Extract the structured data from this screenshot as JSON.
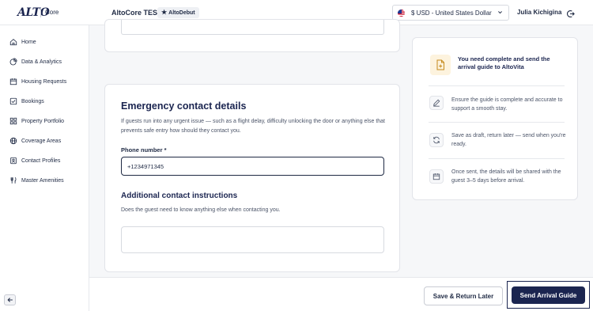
{
  "header": {
    "logo_text": "ALTO",
    "logo_sub": "Core",
    "account_name": "AltoCore TEST",
    "badge_label": "AltoDebut",
    "currency": {
      "selected": "$ USD - United States Dollar",
      "flag_icon": "us-flag-icon"
    },
    "user_name": "Julia Kichigina",
    "logout_icon": "logout-icon"
  },
  "sidebar": {
    "items": [
      {
        "label": "Home",
        "icon": "home-icon"
      },
      {
        "label": "Data & Analytics",
        "icon": "analytics-icon"
      },
      {
        "label": "Housing Requests",
        "icon": "calendar-icon"
      },
      {
        "label": "Bookings",
        "icon": "bookings-icon"
      },
      {
        "label": "Property Portfolio",
        "icon": "grid-icon"
      },
      {
        "label": "Coverage Areas",
        "icon": "globe-icon"
      },
      {
        "label": "Contact Profiles",
        "icon": "contact-icon"
      },
      {
        "label": "Master Amenities",
        "icon": "amenities-icon"
      }
    ],
    "collapse_icon": "arrow-left-icon"
  },
  "form": {
    "section_title": "Emergency contact details",
    "section_description": "If guests run into any urgent issue — such as a flight delay, difficulty unlocking the door or anything else that prevents safe entry how should they contact you.",
    "phone_label": "Phone number *",
    "phone_value": "+1234971345",
    "additional_title": "Additional contact instructions",
    "additional_description": "Does the guest need to know anything else when contacting you.",
    "additional_value": ""
  },
  "info_panel": {
    "title": "You need complete and send the arrival guide to AltoVita",
    "items": [
      {
        "text": "Ensure the guide is complete and accurate to support a smooth stay.",
        "icon": "edit-icon"
      },
      {
        "text": "Save as draft, return later — send when you're ready.",
        "icon": "refresh-icon"
      },
      {
        "text": "Once sent, the details will be shared with the guest 3–5 days before arrival.",
        "icon": "calendar-icon"
      }
    ]
  },
  "actions": {
    "save_label": "Save & Return Later",
    "send_label": "Send Arrival Guide"
  },
  "colors": {
    "primary": "#1b2550",
    "accent_soft": "#fdf3de",
    "background": "#f6f7f9"
  }
}
